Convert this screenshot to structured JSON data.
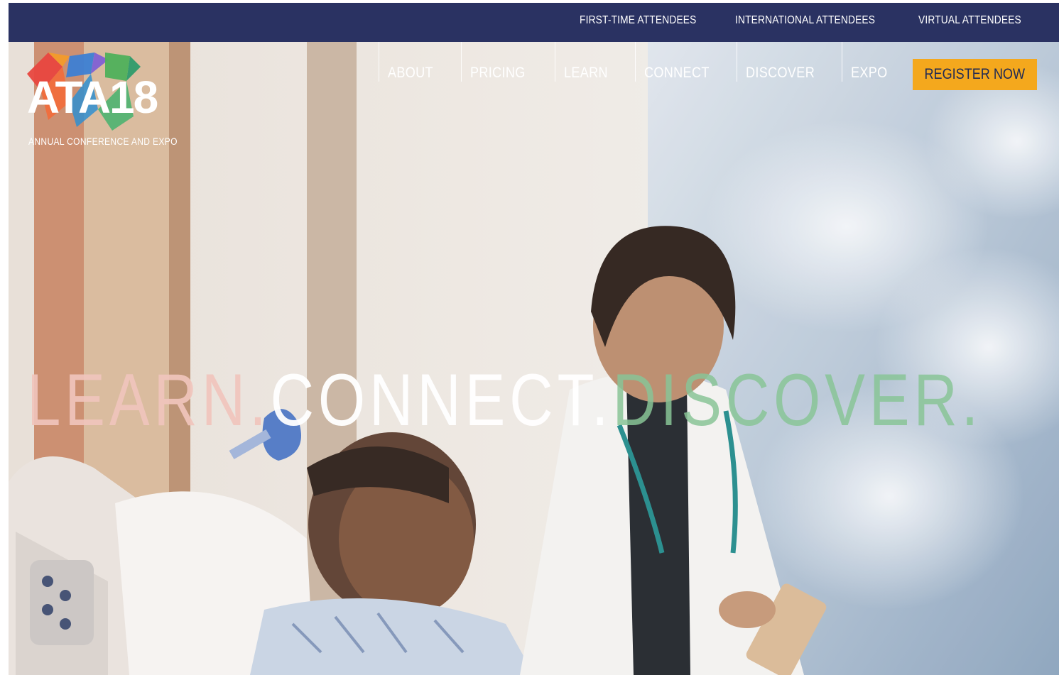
{
  "top_bar": {
    "links": [
      {
        "label": "FIRST-TIME ATTENDEES"
      },
      {
        "label": "INTERNATIONAL ATTENDEES"
      },
      {
        "label": "VIRTUAL ATTENDEES"
      }
    ]
  },
  "logo": {
    "text": "ATA18",
    "tagline": "ANNUAL CONFERENCE AND EXPO"
  },
  "main_nav": {
    "items": [
      {
        "label": "ABOUT"
      },
      {
        "label": "PRICING"
      },
      {
        "label": "LEARN"
      },
      {
        "label": "CONNECT"
      },
      {
        "label": "DISCOVER"
      },
      {
        "label": "EXPO"
      }
    ],
    "register_label": "REGISTER NOW"
  },
  "hero": {
    "headline_1": "LEARN.",
    "headline_2": "CONNECT.",
    "headline_3": "DISCOVER."
  },
  "colors": {
    "top_bar_bg": "#2a3262",
    "register_bg": "#f4a81d",
    "register_text": "#1f2a55",
    "headline_learn": "#f0c4bc",
    "headline_connect": "#ffffff",
    "headline_discover": "#88c496"
  }
}
